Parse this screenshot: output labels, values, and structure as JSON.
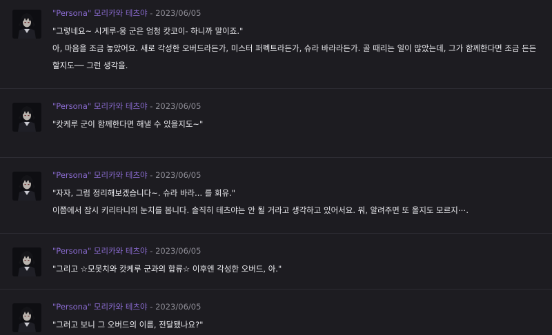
{
  "comments": [
    {
      "author": "\"Persona\" 모리카와 테츠야",
      "separator": " - ",
      "date": "2023/06/05",
      "text": "\"그렇네요~ 시게루-웅 군은 엄청 캇코이- 하니까 말이죠.\"\n아, 마음을 조금 놓았어요. 새로 각성한 오버드라든가, 미스터 퍼펙트라든가, 슈라 바라라든가. 골 때리는 일이 많았는데, 그가 함께한다면 조금 든든할지도── 그런 생각을."
    },
    {
      "author": "\"Persona\" 모리카와 테츠야",
      "separator": " - ",
      "date": "2023/06/05",
      "text": "\"캇케루 군이 함께한다면 해낼 수 있을지도~\""
    },
    {
      "author": "\"Persona\" 모리카와 테츠야",
      "separator": " - ",
      "date": "2023/06/05",
      "text": "\"자자, 그럼 정리해보겠습니다~. 슈라 바라... 를 회유.\"\n이쯤에서 잠시 키리타니의 눈치를 봅니다. 솔직히 테츠야는 안 될 거라고 생각하고 있어서요. 뭐, 알려주면 또 올지도 모르지⋯."
    },
    {
      "author": "\"Persona\" 모리카와 테츠야",
      "separator": " - ",
      "date": "2023/06/05",
      "text": "\"그리고 ☆모못치와 캇케루 군과의 합류☆ 이후엔 각성한 오버드, 아.\""
    },
    {
      "author": "\"Persona\" 모리카와 테츠야",
      "separator": " - ",
      "date": "2023/06/05",
      "text": "\"그러고 보니 그 오버드의 이름, 전달됐나요?\""
    }
  ],
  "avatar_icon": "character-portrait-icon",
  "colors": {
    "background": "#1d1c21",
    "author": "#8a6bd1",
    "date": "#8e8d96",
    "text": "#ececf0",
    "divider": "#2d2c33"
  }
}
